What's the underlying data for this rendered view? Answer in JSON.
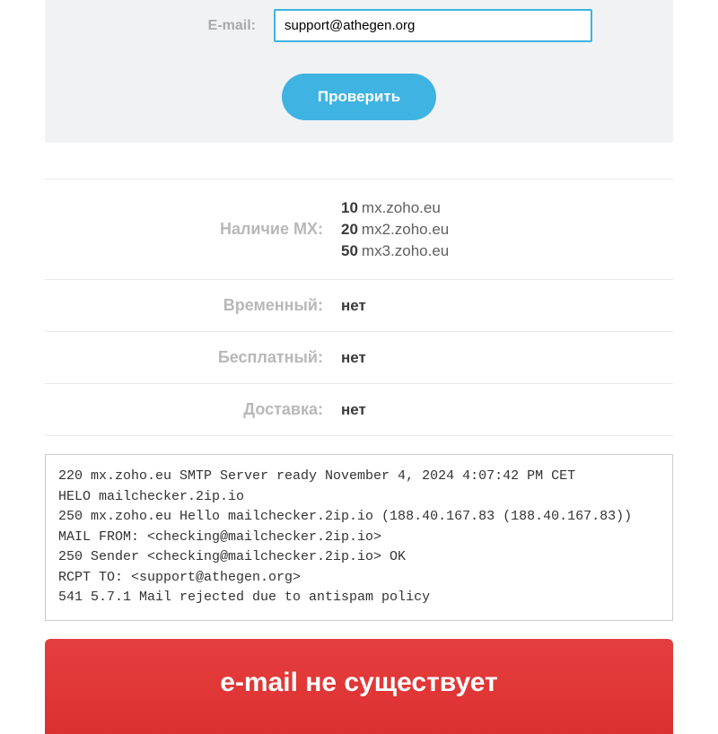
{
  "form": {
    "email_label": "E-mail:",
    "email_value": "support@athegen.org",
    "check_button": "Проверить"
  },
  "results": {
    "mx_label": "Наличие MX:",
    "mx_records": [
      {
        "priority": "10",
        "host": "mx.zoho.eu"
      },
      {
        "priority": "20",
        "host": "mx2.zoho.eu"
      },
      {
        "priority": "50",
        "host": "mx3.zoho.eu"
      }
    ],
    "temporary_label": "Временный:",
    "temporary_value": "нет",
    "free_label": "Бесплатный:",
    "free_value": "нет",
    "delivery_label": "Доставка:",
    "delivery_value": "нет"
  },
  "log": "220 mx.zoho.eu SMTP Server ready November 4, 2024 4:07:42 PM CET\nHELO mailchecker.2ip.io\n250 mx.zoho.eu Hello mailchecker.2ip.io (188.40.167.83 (188.40.167.83))\nMAIL FROM: <checking@mailchecker.2ip.io>\n250 Sender <checking@mailchecker.2ip.io> OK\nRCPT TO: <support@athegen.org>\n541 5.7.1 Mail rejected due to antispam policy",
  "banner": "e-mail не существует"
}
